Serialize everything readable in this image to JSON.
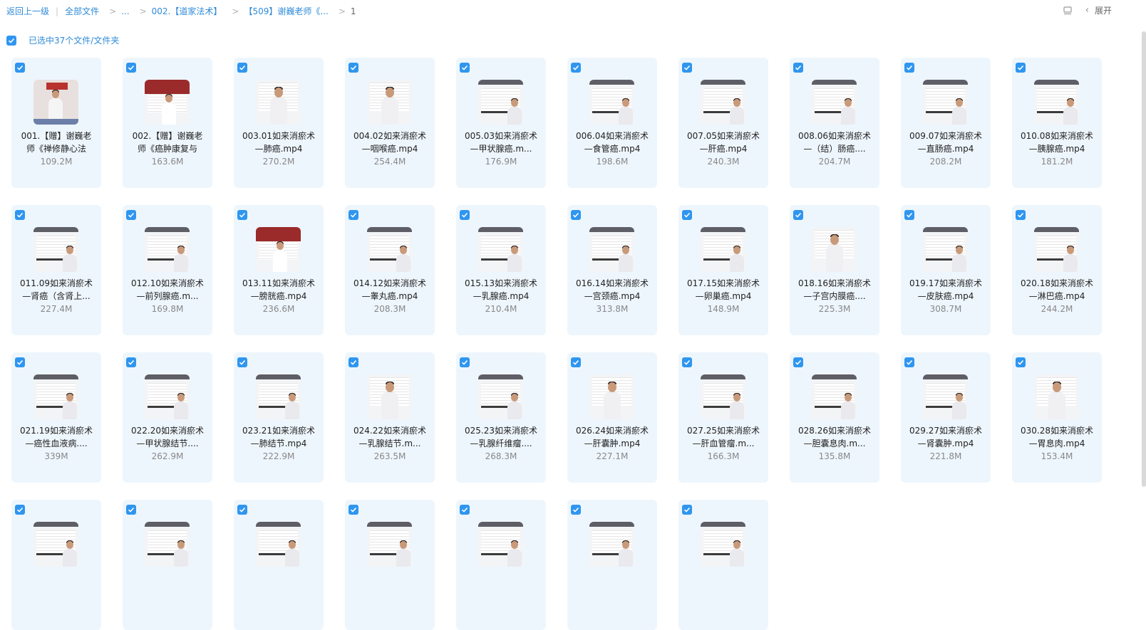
{
  "breadcrumb": {
    "back": "返回上一级",
    "all_files": "全部文件",
    "ellipsis": "...",
    "folder1": "002.【道家法术】",
    "folder2": "【509】谢巍老师《...",
    "current": "1"
  },
  "toolbar": {
    "expand_label": "展开",
    "layout_icon": "list-layout-icon",
    "chevron_icon": "chevron-left-icon"
  },
  "selection": {
    "label": "已选中37个文件/文件夹",
    "checked": true
  },
  "colors": {
    "accent": "#2f96f0",
    "link": "#2f8bd8",
    "card_bg": "#eef6fd"
  },
  "files": [
    {
      "line1": "001.【赠】谢巍老",
      "line2": "师《禅修静心法",
      "size": "109.2M",
      "thumb": "meditation"
    },
    {
      "line1": "002.【赠】谢巍老",
      "line2": "师《癌肿康复与",
      "size": "163.6M",
      "thumb": "redbanner"
    },
    {
      "line1": "003.01如来消瘀术",
      "line2": "—肺癌.mp4",
      "size": "270.2M",
      "thumb": "closeup"
    },
    {
      "line1": "004.02如来消瘀术",
      "line2": "—咽喉癌.mp4",
      "size": "254.4M",
      "thumb": "closeup"
    },
    {
      "line1": "005.03如来消瘀术",
      "line2": "—甲状腺癌.m...",
      "size": "176.9M",
      "thumb": "slide"
    },
    {
      "line1": "006.04如来消瘀术",
      "line2": "—食管癌.mp4",
      "size": "198.6M",
      "thumb": "slide"
    },
    {
      "line1": "007.05如来消瘀术",
      "line2": "—肝癌.mp4",
      "size": "240.3M",
      "thumb": "slide"
    },
    {
      "line1": "008.06如来消瘀术",
      "line2": "—（结）肠癌....",
      "size": "204.7M",
      "thumb": "slide"
    },
    {
      "line1": "009.07如来消瘀术",
      "line2": "—直肠癌.mp4",
      "size": "208.2M",
      "thumb": "slide"
    },
    {
      "line1": "010.08如来消瘀术",
      "line2": "—胰腺癌.mp4",
      "size": "181.2M",
      "thumb": "slide"
    },
    {
      "line1": "011.09如来消瘀术",
      "line2": "—肾癌（含肾上...",
      "size": "227.4M",
      "thumb": "slide"
    },
    {
      "line1": "012.10如来消瘀术",
      "line2": "—前列腺癌.m...",
      "size": "169.8M",
      "thumb": "slide"
    },
    {
      "line1": "013.11如来消瘀术",
      "line2": "—膀胱癌.mp4",
      "size": "236.6M",
      "thumb": "redbanner"
    },
    {
      "line1": "014.12如来消瘀术",
      "line2": "—睾丸癌.mp4",
      "size": "208.3M",
      "thumb": "slide"
    },
    {
      "line1": "015.13如来消瘀术",
      "line2": "—乳腺癌.mp4",
      "size": "210.4M",
      "thumb": "slide"
    },
    {
      "line1": "016.14如来消瘀术",
      "line2": "—宫颈癌.mp4",
      "size": "313.8M",
      "thumb": "slide"
    },
    {
      "line1": "017.15如来消瘀术",
      "line2": "—卵巢癌.mp4",
      "size": "148.9M",
      "thumb": "slide"
    },
    {
      "line1": "018.16如来消瘀术",
      "line2": "—子宫内膜癌....",
      "size": "225.3M",
      "thumb": "closeup"
    },
    {
      "line1": "019.17如来消瘀术",
      "line2": "—皮肤癌.mp4",
      "size": "308.7M",
      "thumb": "slide"
    },
    {
      "line1": "020.18如来消瘀术",
      "line2": "—淋巴癌.mp4",
      "size": "244.2M",
      "thumb": "slide"
    },
    {
      "line1": "021.19如来消瘀术",
      "line2": "—癌性血液病....",
      "size": "339M",
      "thumb": "slide"
    },
    {
      "line1": "022.20如来消瘀术",
      "line2": "—甲状腺结节....",
      "size": "262.9M",
      "thumb": "slide"
    },
    {
      "line1": "023.21如来消瘀术",
      "line2": "—肺结节.mp4",
      "size": "222.9M",
      "thumb": "slide"
    },
    {
      "line1": "024.22如来消瘀术",
      "line2": "—乳腺结节.m...",
      "size": "263.5M",
      "thumb": "closeup"
    },
    {
      "line1": "025.23如来消瘀术",
      "line2": "—乳腺纤维瘤....",
      "size": "268.3M",
      "thumb": "slide"
    },
    {
      "line1": "026.24如来消瘀术",
      "line2": "—肝囊肿.mp4",
      "size": "227.1M",
      "thumb": "closeup"
    },
    {
      "line1": "027.25如来消瘀术",
      "line2": "—肝血管瘤.m...",
      "size": "166.3M",
      "thumb": "slide"
    },
    {
      "line1": "028.26如来消瘀术",
      "line2": "—胆囊息肉.m...",
      "size": "135.8M",
      "thumb": "slide"
    },
    {
      "line1": "029.27如来消瘀术",
      "line2": "—肾囊肿.mp4",
      "size": "221.8M",
      "thumb": "slide"
    },
    {
      "line1": "030.28如来消瘀术",
      "line2": "—胃息肉.mp4",
      "size": "153.4M",
      "thumb": "closeup"
    },
    {
      "line1": "",
      "line2": "",
      "size": "",
      "thumb": "slide"
    },
    {
      "line1": "",
      "line2": "",
      "size": "",
      "thumb": "slide"
    },
    {
      "line1": "",
      "line2": "",
      "size": "",
      "thumb": "slide"
    },
    {
      "line1": "",
      "line2": "",
      "size": "",
      "thumb": "slide"
    },
    {
      "line1": "",
      "line2": "",
      "size": "",
      "thumb": "slide"
    },
    {
      "line1": "",
      "line2": "",
      "size": "",
      "thumb": "slide"
    },
    {
      "line1": "",
      "line2": "",
      "size": "",
      "thumb": "slide"
    }
  ]
}
